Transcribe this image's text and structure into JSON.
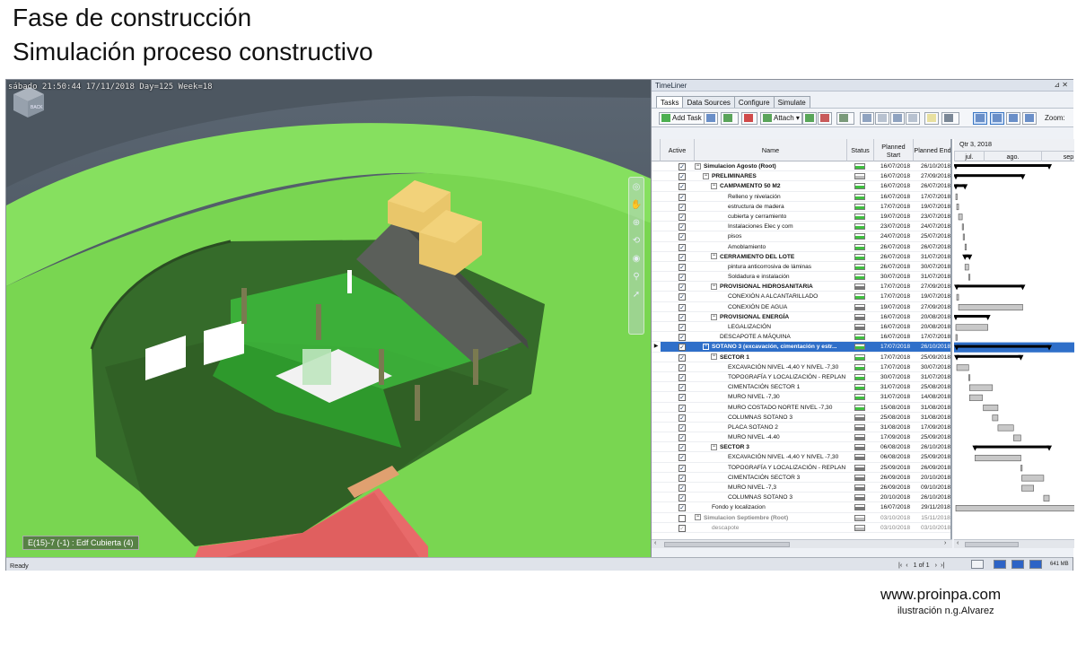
{
  "slide": {
    "title_line1": "Fase de construcción",
    "title_line2": "Simulación proceso constructivo",
    "website": "www.proinpa.com",
    "credit": "ilustración n.g.Alvarez"
  },
  "viewport": {
    "overlay_text": "sábado 21:50:44 17/11/2018 Day=125 Week=18",
    "element_tip": "E(15)-7 (-1) : Edf Cubierta (4)",
    "viewcube_label": "BACK"
  },
  "timeliner": {
    "title": "TimeLiner",
    "tabs": [
      "Tasks",
      "Data Sources",
      "Configure",
      "Simulate"
    ],
    "toolbar": {
      "add_task": "Add Task",
      "attach": "Attach",
      "zoom_label": "Zoom:"
    },
    "columns": {
      "active": "Active",
      "name": "Name",
      "status": "Status",
      "planned_start_1": "Planned",
      "planned_start_2": "Start",
      "planned_end": "Planned End"
    },
    "gantt": {
      "quarter": "Qtr 3, 2018",
      "months": [
        "jul.",
        "ago.",
        "sep"
      ]
    },
    "tasks": [
      {
        "name": "Simulacion Agosto (Root)",
        "start": "16/07/2018",
        "end": "26/10/2018",
        "level": 0,
        "bold": true,
        "expand": "−",
        "status": "green",
        "bar": [
          0,
          102
        ],
        "summary": true
      },
      {
        "name": "PRELIMINARES",
        "start": "16/07/2018",
        "end": "27/09/2018",
        "level": 1,
        "bold": true,
        "expand": "−",
        "status": "light",
        "bar": [
          0,
          73
        ],
        "summary": true
      },
      {
        "name": "CAMPAMENTO 50 M2",
        "start": "16/07/2018",
        "end": "26/07/2018",
        "level": 2,
        "bold": true,
        "expand": "−",
        "status": "green",
        "bar": [
          0,
          10
        ],
        "summary": true
      },
      {
        "name": "Relleno y nivelación",
        "start": "16/07/2018",
        "end": "17/07/2018",
        "level": 3,
        "status": "green",
        "bar": [
          0,
          1
        ]
      },
      {
        "name": "estructura de madera",
        "start": "17/07/2018",
        "end": "19/07/2018",
        "level": 3,
        "status": "green",
        "bar": [
          1,
          3
        ]
      },
      {
        "name": "cubierta y cerramiento",
        "start": "19/07/2018",
        "end": "23/07/2018",
        "level": 3,
        "status": "green",
        "bar": [
          3,
          7
        ]
      },
      {
        "name": "Instalaciones Elec y com",
        "start": "23/07/2018",
        "end": "24/07/2018",
        "level": 3,
        "status": "green",
        "bar": [
          7,
          8
        ]
      },
      {
        "name": "pisos",
        "start": "24/07/2018",
        "end": "25/07/2018",
        "level": 3,
        "status": "green",
        "bar": [
          8,
          9
        ]
      },
      {
        "name": "Amoblamiento",
        "start": "26/07/2018",
        "end": "26/07/2018",
        "level": 3,
        "status": "green",
        "bar": [
          10,
          10
        ]
      },
      {
        "name": "CERRAMIENTO DEL LOTE",
        "start": "26/07/2018",
        "end": "31/07/2018",
        "level": 2,
        "bold": true,
        "expand": "−",
        "status": "green",
        "bar": [
          10,
          15
        ],
        "summary": true
      },
      {
        "name": "pintura anticorrosiva de láminas",
        "start": "26/07/2018",
        "end": "30/07/2018",
        "level": 3,
        "status": "green",
        "bar": [
          10,
          14
        ]
      },
      {
        "name": "Soldadura e instalación",
        "start": "30/07/2018",
        "end": "31/07/2018",
        "level": 3,
        "status": "green",
        "bar": [
          14,
          15
        ]
      },
      {
        "name": "PROVISIONAL HIDROSANITARIA",
        "start": "17/07/2018",
        "end": "27/09/2018",
        "level": 2,
        "bold": true,
        "expand": "−",
        "status": "gray",
        "bar": [
          1,
          73
        ],
        "summary": true
      },
      {
        "name": "CONEXIÓN A ALCANTARILLADO",
        "start": "17/07/2018",
        "end": "19/07/2018",
        "level": 3,
        "status": "green",
        "bar": [
          1,
          3
        ]
      },
      {
        "name": "CONEXIÓN DE AGUA",
        "start": "19/07/2018",
        "end": "27/09/2018",
        "level": 3,
        "status": "gray",
        "bar": [
          3,
          73
        ]
      },
      {
        "name": "PROVISIONAL ENERGÍA",
        "start": "16/07/2018",
        "end": "20/08/2018",
        "level": 2,
        "bold": true,
        "expand": "−",
        "status": "gray",
        "bar": [
          0,
          35
        ],
        "summary": true
      },
      {
        "name": "LEGALIZACIÓN",
        "start": "16/07/2018",
        "end": "20/08/2018",
        "level": 3,
        "status": "gray",
        "bar": [
          0,
          35
        ]
      },
      {
        "name": "DESCAPOTE A MÁQUINA",
        "start": "16/07/2018",
        "end": "17/07/2018",
        "level": 2,
        "status": "green",
        "bar": [
          0,
          1
        ]
      },
      {
        "name": "SOTANO 3 (excavación, cimentación y estr...",
        "start": "17/07/2018",
        "end": "26/10/2018",
        "level": 1,
        "bold": true,
        "expand": "−",
        "status": "green",
        "bar": [
          1,
          102
        ],
        "summary": true,
        "selected": true
      },
      {
        "name": "SECTOR 1",
        "start": "17/07/2018",
        "end": "25/09/2018",
        "level": 2,
        "bold": true,
        "expand": "−",
        "status": "green",
        "bar": [
          1,
          71
        ],
        "summary": true
      },
      {
        "name": "EXCAVACIÓN NIVEL -4,40 Y NIVEL -7,30",
        "start": "17/07/2018",
        "end": "30/07/2018",
        "level": 3,
        "status": "green",
        "bar": [
          1,
          14
        ]
      },
      {
        "name": "TOPOGRAFÍA Y LOCALIZACIÓN - REPLANTEO ...",
        "start": "30/07/2018",
        "end": "31/07/2018",
        "level": 3,
        "status": "green",
        "bar": [
          14,
          15
        ]
      },
      {
        "name": "CIMENTACIÓN SECTOR 1",
        "start": "31/07/2018",
        "end": "25/08/2018",
        "level": 3,
        "status": "green",
        "bar": [
          15,
          40
        ]
      },
      {
        "name": "MURO NIVEL -7,30",
        "start": "31/07/2018",
        "end": "14/08/2018",
        "level": 3,
        "status": "green",
        "bar": [
          15,
          29
        ]
      },
      {
        "name": "MURO COSTADO NORTE NIVEL -7,30",
        "start": "15/08/2018",
        "end": "31/08/2018",
        "level": 3,
        "status": "green",
        "bar": [
          30,
          46
        ]
      },
      {
        "name": "COLUMNAS SOTANO 3",
        "start": "25/08/2018",
        "end": "31/08/2018",
        "level": 3,
        "status": "gray",
        "bar": [
          40,
          46
        ]
      },
      {
        "name": "PLACA SOTANO 2",
        "start": "31/08/2018",
        "end": "17/09/2018",
        "level": 3,
        "status": "gray",
        "bar": [
          46,
          63
        ]
      },
      {
        "name": "MURO NIVEL -4.40",
        "start": "17/09/2018",
        "end": "25/09/2018",
        "level": 3,
        "status": "gray",
        "bar": [
          63,
          71
        ]
      },
      {
        "name": "SECTOR 3",
        "start": "06/08/2018",
        "end": "26/10/2018",
        "level": 2,
        "bold": true,
        "expand": "−",
        "status": "gray",
        "bar": [
          21,
          102
        ],
        "summary": true
      },
      {
        "name": "EXCAVACIÓN NIVEL -4,40 Y NIVEL -7,30",
        "start": "06/08/2018",
        "end": "25/09/2018",
        "level": 3,
        "status": "gray",
        "bar": [
          21,
          71
        ]
      },
      {
        "name": "TOPOGRAFÍA Y LOCALIZACIÓN - REPLANTEO ...",
        "start": "25/09/2018",
        "end": "26/09/2018",
        "level": 3,
        "status": "gray",
        "bar": [
          71,
          72
        ]
      },
      {
        "name": "CIMENTACIÓN SECTOR 3",
        "start": "26/09/2018",
        "end": "20/10/2018",
        "level": 3,
        "status": "gray",
        "bar": [
          72,
          96
        ]
      },
      {
        "name": "MURO NIVEL -7,3",
        "start": "26/09/2018",
        "end": "09/10/2018",
        "level": 3,
        "status": "gray",
        "bar": [
          72,
          85
        ]
      },
      {
        "name": "COLUMNAS SOTANO 3",
        "start": "20/10/2018",
        "end": "26/10/2018",
        "level": 3,
        "status": "gray",
        "bar": [
          96,
          102
        ]
      },
      {
        "name": "Fondo y localizacion",
        "start": "16/07/2018",
        "end": "29/11/2018",
        "level": 1,
        "status": "gray",
        "bar": [
          0,
          136
        ]
      },
      {
        "name": "Simulacion Septiembre (Root)",
        "start": "03/10/2018",
        "end": "15/11/2018",
        "level": 0,
        "bold": true,
        "expand": "−",
        "status": "light",
        "gray": true,
        "unchecked": true
      },
      {
        "name": "descapote",
        "start": "03/10/2018",
        "end": "03/10/2018",
        "level": 1,
        "status": "light",
        "gray": true
      }
    ]
  },
  "statusbar": {
    "text": "Ready",
    "page": "1 of 1",
    "memory": "641 MB"
  },
  "colors": {
    "selection": "#2f6fc9",
    "gantt_bar": "#c8c8c8",
    "summary_bar": "#000000",
    "grass": "#7ed957",
    "building_green": "#3fbf3f"
  }
}
